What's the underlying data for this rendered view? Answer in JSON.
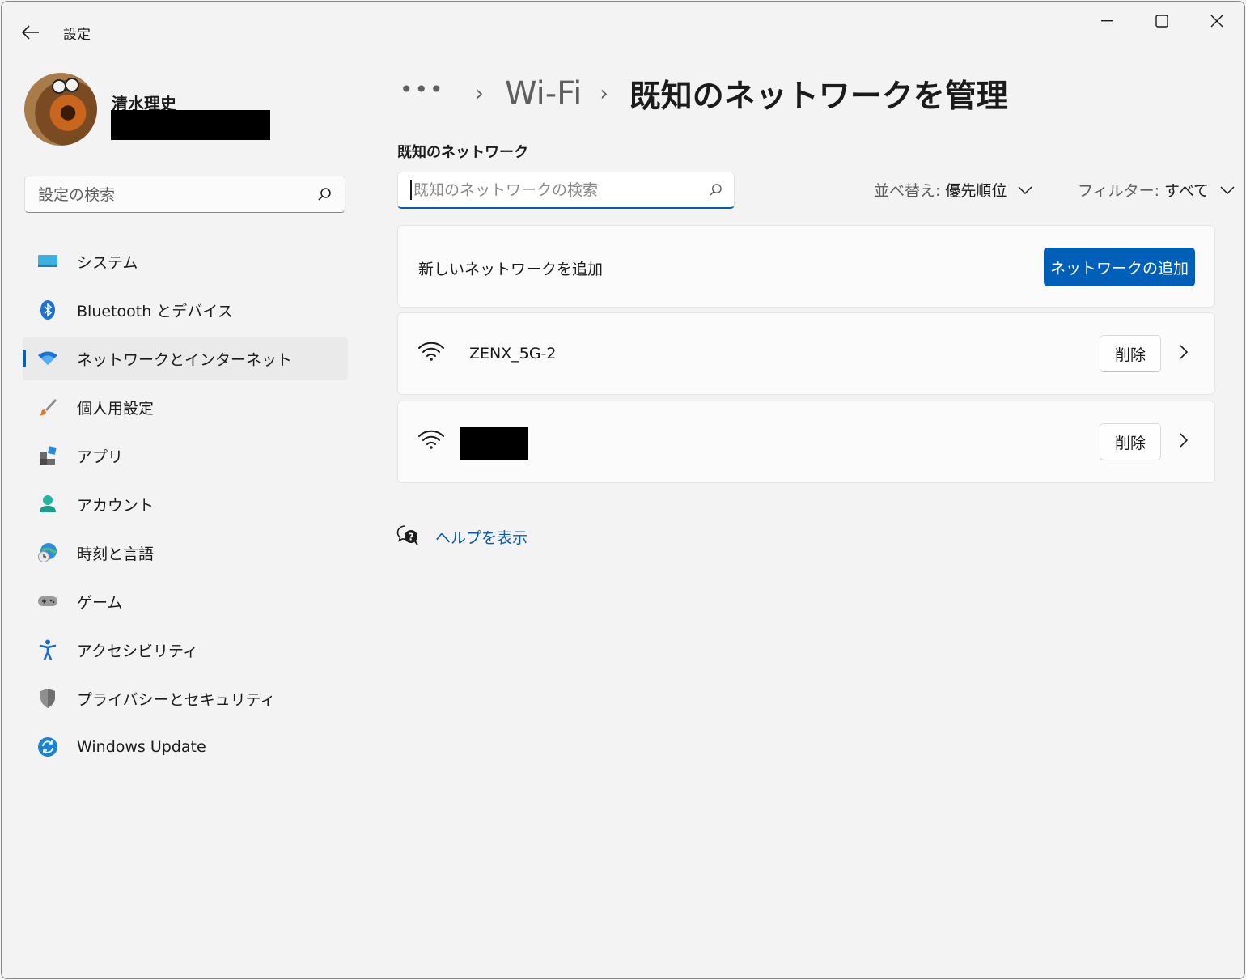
{
  "app": {
    "title": "設定"
  },
  "user": {
    "name": "清水理史"
  },
  "search": {
    "placeholder": "設定の検索"
  },
  "nav": {
    "items": [
      {
        "label": "システム",
        "icon": "display-icon"
      },
      {
        "label": "Bluetooth とデバイス",
        "icon": "bluetooth-icon"
      },
      {
        "label": "ネットワークとインターネット",
        "icon": "wifi-icon",
        "selected": true
      },
      {
        "label": "個人用設定",
        "icon": "brush-icon"
      },
      {
        "label": "アプリ",
        "icon": "apps-icon"
      },
      {
        "label": "アカウント",
        "icon": "person-icon"
      },
      {
        "label": "時刻と言語",
        "icon": "globe-clock-icon"
      },
      {
        "label": "ゲーム",
        "icon": "gamepad-icon"
      },
      {
        "label": "アクセシビリティ",
        "icon": "accessibility-icon"
      },
      {
        "label": "プライバシーとセキュリティ",
        "icon": "shield-icon"
      },
      {
        "label": "Windows Update",
        "icon": "update-icon"
      }
    ]
  },
  "breadcrumb": {
    "more": "•••",
    "parent": "Wi-Fi",
    "current": "既知のネットワークを管理"
  },
  "known": {
    "section_title": "既知のネットワーク",
    "search_placeholder": "既知のネットワークの検索",
    "sort_key": "並べ替え:",
    "sort_value": "優先順位",
    "filter_key": "フィルター:",
    "filter_value": "すべて",
    "add_label": "新しいネットワークを追加",
    "add_button": "ネットワークの追加",
    "networks": [
      {
        "ssid": "ZENX_5G-2",
        "delete": "削除"
      },
      {
        "ssid": "",
        "redacted": true,
        "delete": "削除"
      }
    ]
  },
  "help": {
    "label": "ヘルプを表示"
  },
  "colors": {
    "accent": "#005fb8",
    "background": "#f3f3f3",
    "card": "#fbfbfb"
  }
}
